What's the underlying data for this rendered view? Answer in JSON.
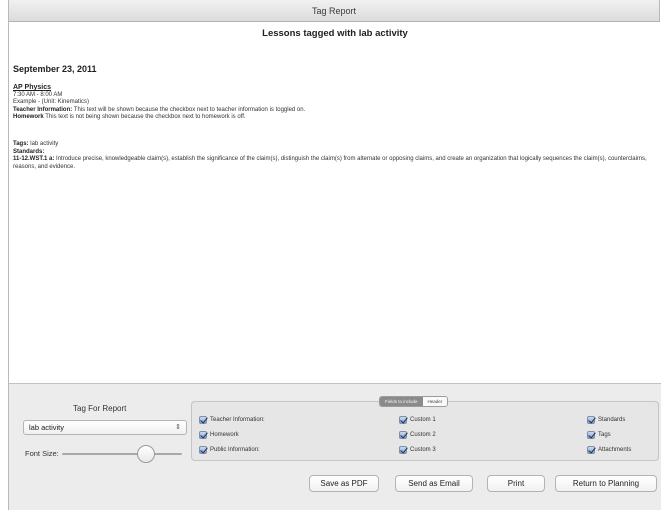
{
  "window": {
    "title": "Tag Report"
  },
  "report": {
    "heading": "Lessons tagged with lab activity",
    "date": "September 23, 2011",
    "course": {
      "title": "AP Physics",
      "time": "7:30 AM - 8:00 AM",
      "example": "Example  - (Unit: Kinematics)",
      "teacher_info_label": "Teacher Information:",
      "teacher_info_text": " This text will be shown because the checkbox next to teacher information  is toggled on.",
      "homework_label": "Homework",
      "homework_text": " This text is not being shown because the checkbox next to homework is off."
    },
    "tags_label": "Tags:",
    "tags_value": "  lab activity",
    "standards_label": "Standards:",
    "standard_code": "11-12.WST.1 a:",
    "standard_text": " Introduce precise, knowledgeable claim(s), establish the significance of the claim(s), distinguish the claim(s) from alternate or opposing claims, and create an organization that logically sequences the claim(s), counterclaims, reasons, and evidence."
  },
  "controls": {
    "tag_for_report_label": "Tag For Report",
    "tag_select_value": "lab activity",
    "stepper_icon": "up-down-stepper-icon",
    "font_size_label": "Font Size:",
    "font_size_level": 0.7,
    "segments": {
      "fields": "Fields to include",
      "header": "Header"
    },
    "checkboxes": {
      "teacher_information": "Teacher Information:",
      "homework": "Homework",
      "public_information": "Public Information:",
      "custom_1": "Custom 1",
      "custom_2": "Custom 2",
      "custom_3": "Custom 3",
      "standards": "Standards",
      "tags": "Tags",
      "attachments": "Attachments"
    },
    "buttons": {
      "save_pdf": "Save as PDF",
      "send_email": "Send as Email",
      "print": "Print",
      "return_planning": "Return to Planning"
    }
  }
}
